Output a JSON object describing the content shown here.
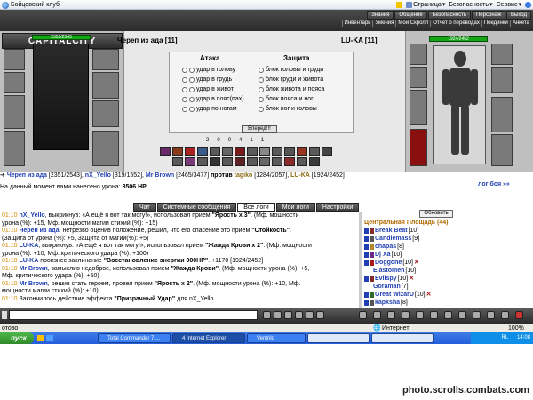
{
  "browser": {
    "title": "Бойцовский клуб",
    "tools": [
      "Страница",
      "Безопасность",
      "Сервис"
    ]
  },
  "game_nav": {
    "top": [
      "Знания",
      "Общение",
      "Безопасность",
      "Персонаж",
      "Выход"
    ],
    "sub": [
      "Инвентарь",
      "Умения",
      "Мой Скролл",
      "Отчет о переводах",
      "Поединки",
      "Анкета"
    ]
  },
  "logo": "CAPITALCITY",
  "fighters": {
    "left": {
      "name": "Череп из ада [11]",
      "hp": "2351/2543",
      "hp_fraction": 0.92
    },
    "right": {
      "name": "LU-KA [11]",
      "hp": "1924/2452",
      "hp_fraction": 0.78
    }
  },
  "combat": {
    "attack_header": "Атака",
    "defense_header": "Защита",
    "attacks": [
      "удар в голову",
      "удар в грудь",
      "удар в живот",
      "удар в пояс(пах)",
      "удар по ногам"
    ],
    "defenses": [
      "блок головы и груди",
      "блок груди и живота",
      "блок живота и пояса",
      "блок пояса и ног",
      "блок ног и головы"
    ],
    "forward_button": "Вперед!!!",
    "counters": [
      "2",
      "0",
      "0",
      "4",
      "1",
      "1"
    ]
  },
  "versus_line": {
    "left_team": [
      {
        "name": "Череп из ада",
        "hp": "[2351/2543]"
      },
      {
        "name": "nX_Yello",
        "hp": "[319/1552]"
      },
      {
        "name": "Mr Brown",
        "hp": "[2465/3477]"
      }
    ],
    "against": "против",
    "right_team": [
      {
        "name": "tagiko",
        "hp": "[1284/2057]"
      },
      {
        "name": "LU-KA",
        "hp": "[1924/2452]"
      }
    ]
  },
  "damage_line": {
    "label": "На данный момент вами нанесено урона:",
    "value": "3506 HP."
  },
  "fight_log_link": "лог боя »»",
  "tabs": [
    "Чат",
    "Системные сообщения",
    "Все логи",
    "Мои логи",
    "Настройки"
  ],
  "active_tab": "Все логи",
  "chat": [
    {
      "time": "01:10",
      "name": "nX_Yello",
      "text": ", выкрикнув: «А ещё я вот так могу!», использовал прием ",
      "bold": "\"Ярость x 3\"",
      "rest": ". (Мф. мощности"
    },
    {
      "time": "",
      "name": "",
      "text": "урона (%): +15, Мф. мощности магии стихий (%): +15)",
      "bold": "",
      "rest": ""
    },
    {
      "time": "01:10",
      "name": "Череп из ада",
      "text": ", нетрезво оценив положение, решил, что его спасение это прием ",
      "bold": "\"Стойкость\"",
      "rest": "."
    },
    {
      "time": "",
      "name": "",
      "text": "(Защита от урона (%): +5, Защита от магии(%): +5)",
      "bold": "",
      "rest": ""
    },
    {
      "time": "01:10",
      "name": "LU-KA",
      "text": ", выкрикнув: «А ещё я вот так могу!», использовал прием ",
      "bold": "\"Жажда Крови x 2\"",
      "rest": ". (Мф. мощности"
    },
    {
      "time": "",
      "name": "",
      "text": "урона (%): +10, Мф. критического удара (%): +100)",
      "bold": "",
      "rest": ""
    },
    {
      "time": "01:10",
      "name": "LU-KA",
      "text": " произнес заклинание ",
      "bold": "\"Восстановление энергии 900HP\"",
      "rest": ". +1170 [1924/2452]"
    },
    {
      "time": "01:10",
      "name": "Mr Brown",
      "text": ", замыслив недоброе, использовал прием ",
      "bold": "\"Жажда Крови\"",
      "rest": ". (Мф. мощности урона (%): +5,"
    },
    {
      "time": "",
      "name": "",
      "text": "Мф. критического удара (%): +50)",
      "bold": "",
      "rest": ""
    },
    {
      "time": "01:10",
      "name": "Mr Brown",
      "text": ", решив стать героем, провел прием ",
      "bold": "\"Ярость x 2\"",
      "rest": ". (Мф. мощности урона (%): +10, Мф."
    },
    {
      "time": "",
      "name": "",
      "text": "мощности магии стихий (%): +10)",
      "bold": "",
      "rest": ""
    },
    {
      "time": "01:10",
      "name": "",
      "text": "Закончилось действие эффекта ",
      "bold": "\"Призрачный Удар\"",
      "rest": " для nX_Yello"
    }
  ],
  "players_panel": {
    "refresh_button": "Обновить",
    "area": "Центральная Площадь (44)",
    "players": [
      {
        "name": "Break Beat",
        "level": "[10]"
      },
      {
        "name": "Candlemass",
        "level": "[9]"
      },
      {
        "name": "chapas",
        "level": "[8]"
      },
      {
        "name": "Dj Xa",
        "level": "[10]"
      },
      {
        "name": "Doggone",
        "level": "[10]"
      },
      {
        "name": "Elastomen",
        "level": "[10]"
      },
      {
        "name": "Evilspy",
        "level": "[10]"
      },
      {
        "name": "Goraman",
        "level": "[7]"
      },
      {
        "name": "Great WizarD",
        "level": "[10]"
      },
      {
        "name": "kapksha",
        "level": "[8]"
      }
    ]
  },
  "status_bar": {
    "left": "отово",
    "zone": "Интернет",
    "zoom": "100%"
  },
  "taskbar": {
    "start": "пуск",
    "tasks": [
      "Total Commander 7....",
      "4 Internet Explorer",
      "Ventrilo"
    ],
    "lang": "RL",
    "time": "14:08"
  },
  "watermark": "photo.scrolls.combats.com"
}
